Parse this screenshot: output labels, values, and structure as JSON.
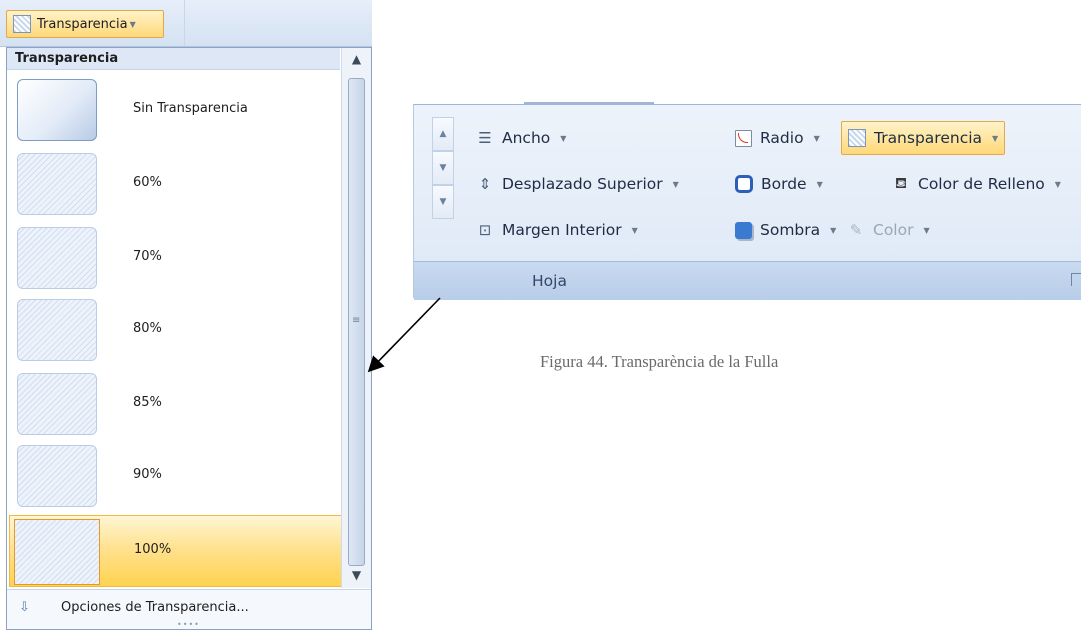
{
  "trigger": {
    "label": "Transparencia",
    "icon": "transparency-icon"
  },
  "dropdown": {
    "header": "Transparencia",
    "items": [
      {
        "label": "Sin Transparencia",
        "selected": false
      },
      {
        "label": "60%",
        "selected": false
      },
      {
        "label": "70%",
        "selected": false
      },
      {
        "label": "80%",
        "selected": false
      },
      {
        "label": "85%",
        "selected": false
      },
      {
        "label": "90%",
        "selected": false
      },
      {
        "label": "100%",
        "selected": true
      }
    ],
    "footer": {
      "label": "Opciones de Transparencia...",
      "icon": "options-arrow-icon"
    }
  },
  "ribbon": {
    "buttons": [
      {
        "label": "Ancho",
        "icon": "width-icon"
      },
      {
        "label": "Desplazado Superior",
        "icon": "offset-top-icon"
      },
      {
        "label": "Margen Interior",
        "icon": "inner-margin-icon"
      },
      {
        "label": "Radio",
        "icon": "radius-icon"
      },
      {
        "label": "Borde",
        "icon": "border-icon"
      },
      {
        "label": "Sombra",
        "icon": "shadow-icon"
      },
      {
        "label": "Transparencia",
        "icon": "transparency-icon"
      },
      {
        "label": "Color de Relleno",
        "icon": "fill-color-icon"
      },
      {
        "label": "Color",
        "icon": "color-icon"
      }
    ],
    "group_label": "Hoja"
  },
  "caption": "Figura 44.  Transparència de la Fulla",
  "colors": {
    "accent_orange": "#e2a94a",
    "ribbon_blue": "#dde8f6",
    "header_blue": "#dde7f5"
  }
}
